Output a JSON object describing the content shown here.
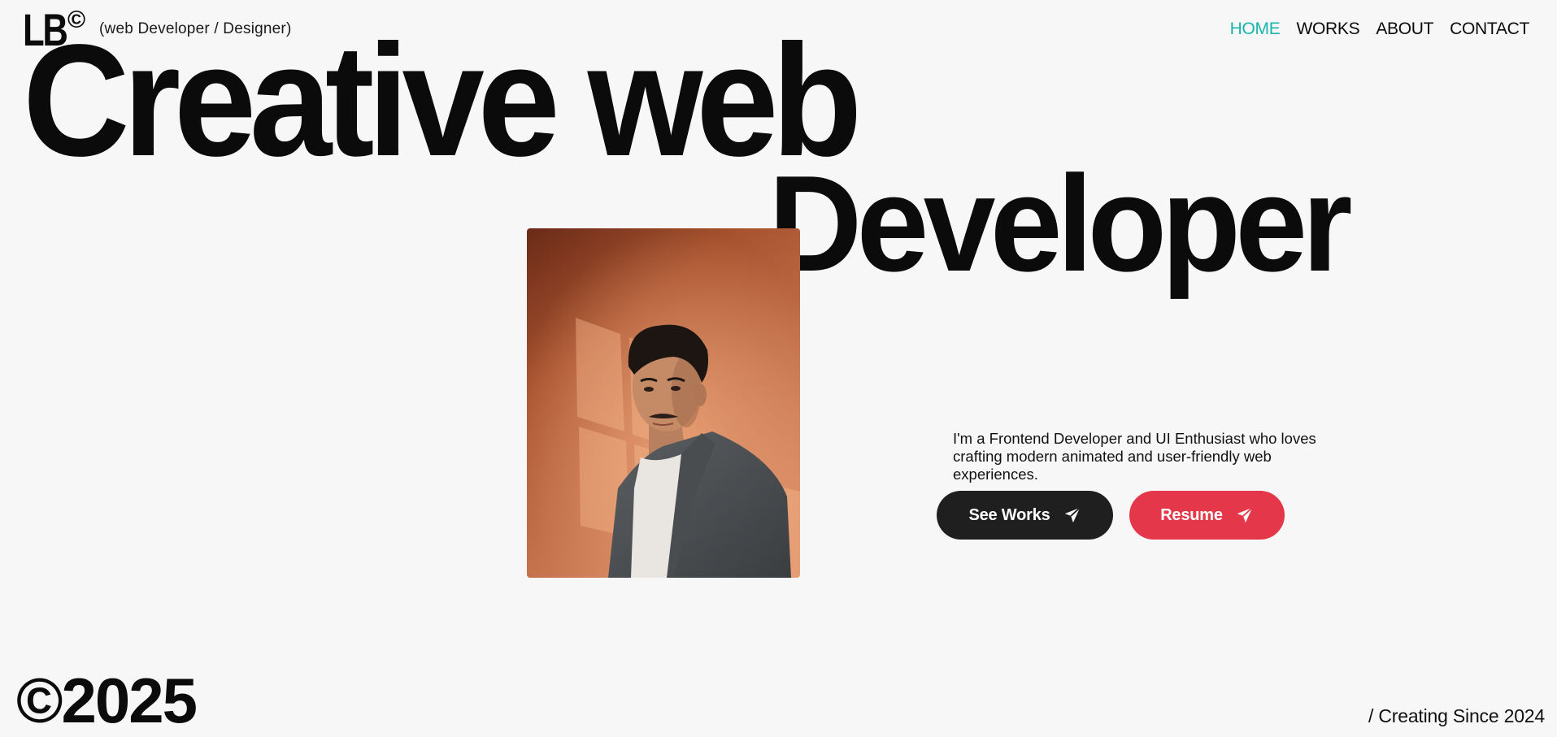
{
  "brand": {
    "logo_text": "LB",
    "logo_symbol": "©",
    "tagline": "(web Developer / Designer)"
  },
  "nav": {
    "items": [
      {
        "label": "HOME",
        "active": true
      },
      {
        "label": "WORKS",
        "active": false
      },
      {
        "label": "ABOUT",
        "active": false
      },
      {
        "label": "CONTACT",
        "active": false
      }
    ]
  },
  "hero": {
    "headline_line1": "Creative web",
    "headline_line2": "Developer",
    "intro": "I'm a Frontend Developer and UI Enthusiast who loves crafting modern animated and user-friendly web experiences.",
    "buttons": {
      "primary": {
        "label": "See Works",
        "icon": "send-icon"
      },
      "secondary": {
        "label": "Resume",
        "icon": "send-icon"
      }
    }
  },
  "footer": {
    "year": "©2025",
    "since": "/ Creating Since 2024"
  },
  "colors": {
    "background": "#f7f7f7",
    "accent": "#18b5ac",
    "dark_button": "#1f1f1f",
    "red_button": "#e4384a"
  }
}
